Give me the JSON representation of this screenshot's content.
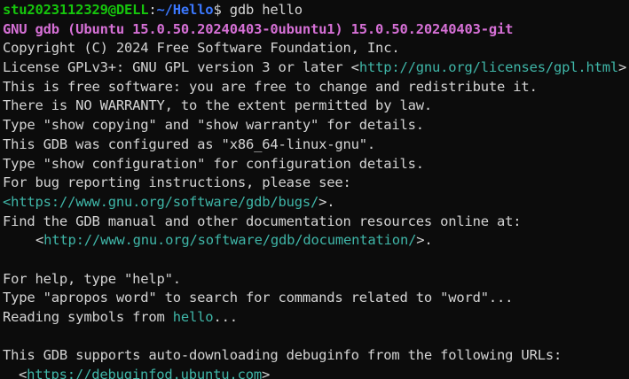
{
  "colors": {
    "background": "#0c0c0c",
    "foreground": "#d4d4d4",
    "prompt_user": "#16c60c",
    "prompt_path": "#3b78ff",
    "gdb_banner": "#d670d6",
    "link": "#3fb6a8"
  },
  "terminal": {
    "prompt": {
      "user_host": "stu2023112329@DELL",
      "separator": ":",
      "path": "~/Hello",
      "symbol": "$",
      "command": " gdb hello"
    },
    "banner": "GNU gdb (Ubuntu 15.0.50.20240403-0ubuntu1) 15.0.50.20240403-git",
    "copyright": "Copyright (C) 2024 Free Software Foundation, Inc.",
    "license": {
      "prefix": "License GPLv3+: GNU GPL version 3 or later <",
      "url": "http://gnu.org/licenses/gpl.html",
      "suffix": ">"
    },
    "free_software": "This is free software: you are free to change and redistribute it.",
    "no_warranty": "There is NO WARRANTY, to the extent permitted by law.",
    "show_copying": "Type \"show copying\" and \"show warranty\" for details.",
    "configured": "This GDB was configured as \"x86_64-linux-gnu\".",
    "show_configuration": "Type \"show configuration\" for configuration details.",
    "bug_reporting": "For bug reporting instructions, please see:",
    "bugs_link": {
      "open": "<",
      "url": "https://www.gnu.org/software/gdb/bugs/",
      "close": ">."
    },
    "manual_intro": "Find the GDB manual and other documentation resources online at:",
    "docs_link": {
      "open": "<",
      "url": "http://www.gnu.org/software/gdb/documentation/",
      "close": ">."
    },
    "help": "For help, type \"help\".",
    "apropos": "Type \"apropos word\" to search for commands related to \"word\"...",
    "reading": {
      "prefix": "Reading symbols from ",
      "file": "hello",
      "suffix": "..."
    },
    "debuginfod_intro": "This GDB supports auto-downloading debuginfo from the following URLs:",
    "debuginfod_link": {
      "open": "<",
      "url": "https://debuginfod.ubuntu.com",
      "close": ">"
    }
  }
}
